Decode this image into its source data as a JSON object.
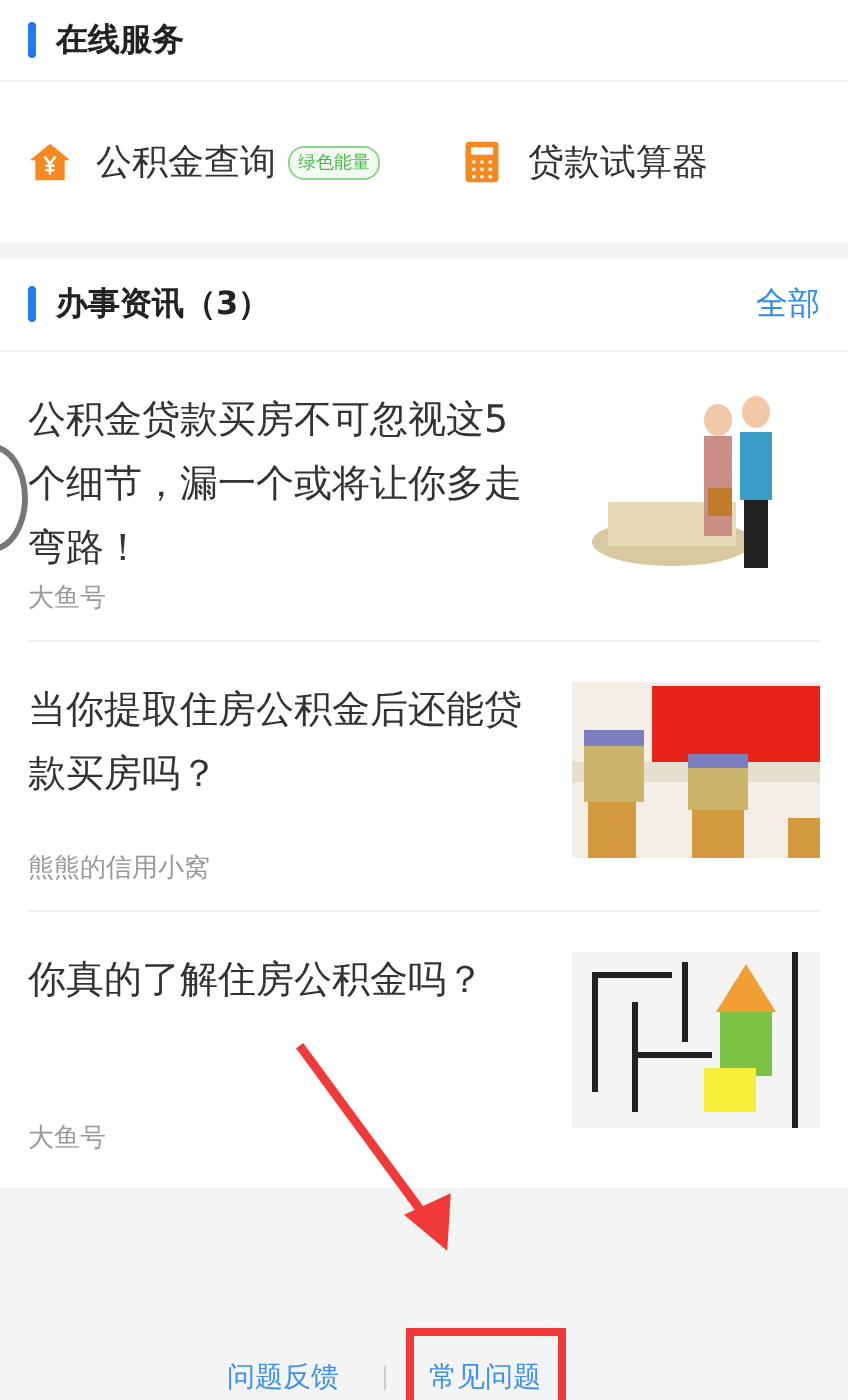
{
  "online_services": {
    "title": "在线服务",
    "items": [
      {
        "kind": "house",
        "label": "公积金查询",
        "badge": "绿色能量"
      },
      {
        "kind": "calculator",
        "label": "贷款试算器"
      }
    ]
  },
  "news": {
    "title": "办事资讯（3）",
    "more": "全部",
    "articles": [
      {
        "title": "公积金贷款买房不可忽视这5个细节，漏一个或将让你多走弯路！",
        "source": "大鱼号"
      },
      {
        "title": "当你提取住房公积金后还能贷款买房吗？",
        "source": "熊熊的信用小窝"
      },
      {
        "title": "你真的了解住房公积金吗？",
        "source": "大鱼号"
      }
    ]
  },
  "footer_links": [
    {
      "label": "问题反馈",
      "highlighted": false
    },
    {
      "label": "常见问题",
      "highlighted": true
    }
  ]
}
